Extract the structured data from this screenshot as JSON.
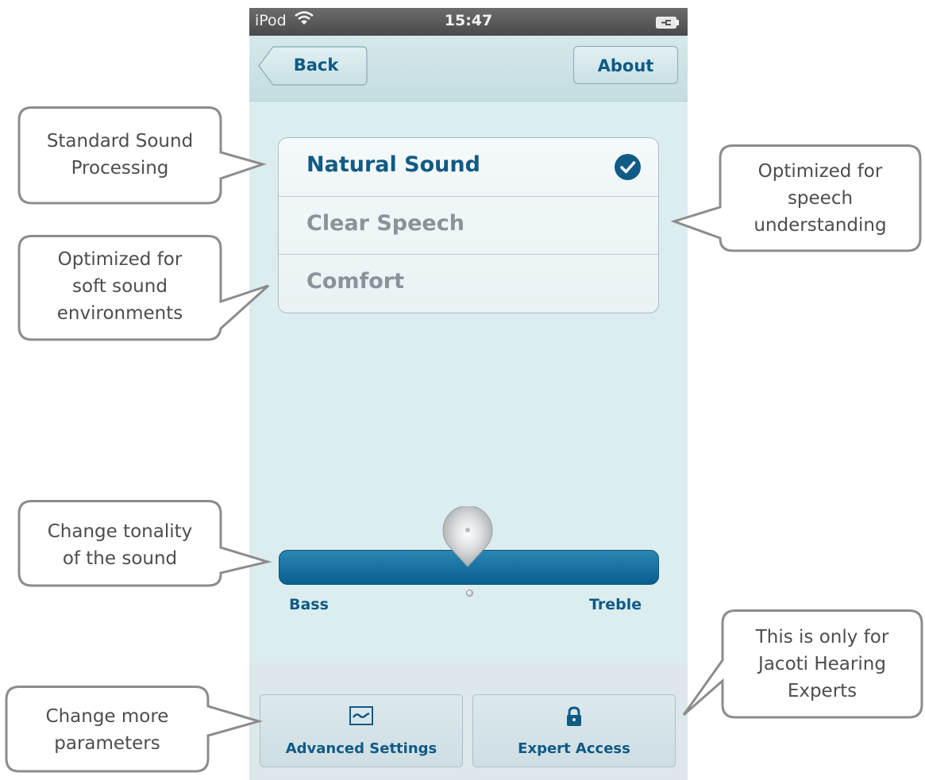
{
  "status_bar": {
    "carrier": "iPod",
    "time": "15:47"
  },
  "nav": {
    "back_label": "Back",
    "about_label": "About"
  },
  "programs": [
    {
      "label": "Natural Sound",
      "selected": true
    },
    {
      "label": "Clear Speech",
      "selected": false
    },
    {
      "label": "Comfort",
      "selected": false
    }
  ],
  "tone_slider": {
    "left_label": "Bass",
    "right_label": "Treble",
    "value": 0.5
  },
  "bottom_buttons": {
    "advanced_label": "Advanced Settings",
    "expert_label": "Expert Access"
  },
  "icons": {
    "wifi": "wifi-icon",
    "battery": "battery-charging-icon",
    "check": "checkmark-icon",
    "advanced": "waveform-icon",
    "expert": "lock-icon"
  },
  "colors": {
    "accent": "#105a86",
    "background": "#dcedef",
    "callout_border": "#8c8c8c"
  },
  "callouts": {
    "standard": [
      "Standard Sound",
      "Processing"
    ],
    "soft": [
      "Optimized for",
      "soft sound",
      "environments"
    ],
    "speech": [
      "Optimized for",
      "speech",
      "understanding"
    ],
    "tonality": [
      "Change tonality",
      "of the sound"
    ],
    "more": [
      "Change more",
      "parameters"
    ],
    "experts": [
      "This is only for",
      "Jacoti Hearing",
      "Experts"
    ]
  }
}
